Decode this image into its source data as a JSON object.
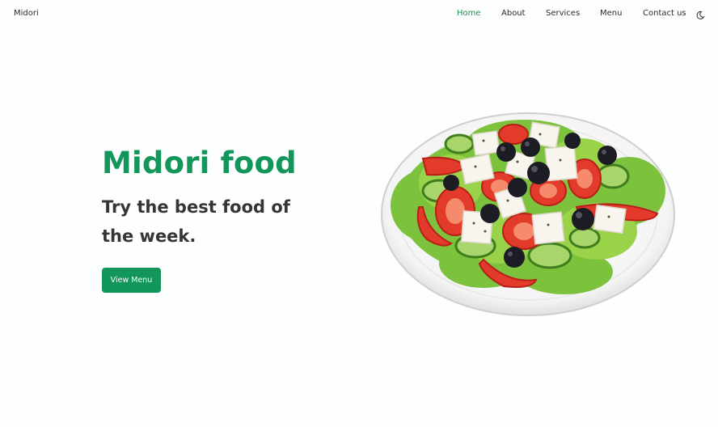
{
  "brand": "Midori",
  "nav": {
    "home": "Home",
    "about": "About",
    "services": "Services",
    "menu": "Menu",
    "contact": "Contact us"
  },
  "theme_toggle_icon": "moon-icon",
  "hero": {
    "title": "Midori food",
    "subtitle": "Try the best food of the week.",
    "button_label": "View Menu",
    "image_icon": "salad-plate-image"
  },
  "colors": {
    "accent": "#12965a",
    "text": "#353535",
    "background": "#fdfefe"
  }
}
